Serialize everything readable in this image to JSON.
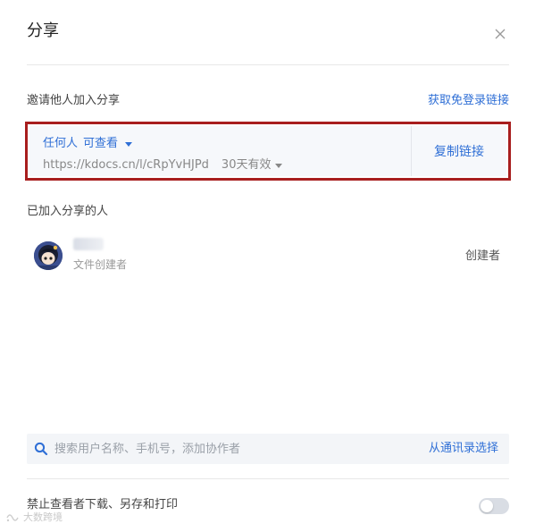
{
  "dialog": {
    "title": "分享",
    "close_icon": "close-icon"
  },
  "invite": {
    "label": "邀请他人加入分享",
    "free_login_link": "获取免登录链接",
    "permission_who": "任何人",
    "permission_level": "可查看",
    "url": "https://kdocs.cn/l/cRpYvHJPd",
    "validity": "30天有效",
    "copy_label": "复制链接",
    "highlight_color": "#a81e1e"
  },
  "members": {
    "label": "已加入分享的人",
    "items": [
      {
        "name": "",
        "subtitle": "文件创建者",
        "role": "创建者"
      }
    ]
  },
  "search": {
    "placeholder": "搜索用户名称、手机号，添加协作者",
    "value": "",
    "contacts_link": "从通讯录选择"
  },
  "settings": {
    "disable_download_label": "禁止查看者下载、另存和打印",
    "disable_download_enabled": false
  },
  "watermark": {
    "text": "大数跨境"
  },
  "colors": {
    "accent": "#2f6fd6",
    "text_primary": "#222222",
    "text_secondary": "#999999"
  }
}
